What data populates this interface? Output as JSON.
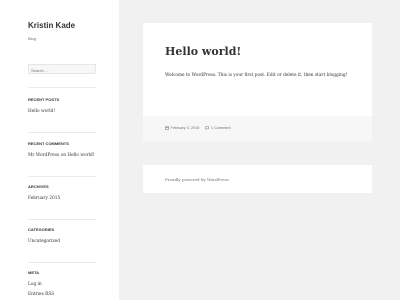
{
  "site": {
    "title": "Kristin Kade",
    "description": "Blog"
  },
  "search": {
    "placeholder": "Search …"
  },
  "widgets": {
    "recent_posts": {
      "title": "RECENT POSTS",
      "items": [
        "Hello world!"
      ]
    },
    "recent_comments": {
      "title": "RECENT COMMENTS",
      "author": "Mr WordPress",
      "connector": "on",
      "post": "Hello world!"
    },
    "archives": {
      "title": "ARCHIVES",
      "items": [
        "February 2015"
      ]
    },
    "categories": {
      "title": "CATEGORIES",
      "items": [
        "Uncategorized"
      ]
    },
    "meta": {
      "title": "META",
      "items": [
        "Log in",
        "Entries RSS"
      ]
    }
  },
  "post": {
    "title": "Hello world!",
    "content": "Welcome to WordPress. This is your first post. Edit or delete it, then start blogging!",
    "date": "February 3, 2015",
    "comments": "1 Comment",
    "icons": [
      "calendar-icon",
      "comment-icon"
    ]
  },
  "footer": {
    "credit": "Proudly powered by WordPress"
  },
  "colors": {
    "sidebar_bg": "#ffffff",
    "page_bg": "#f1f1f1",
    "text": "#333333",
    "muted": "#707070"
  }
}
